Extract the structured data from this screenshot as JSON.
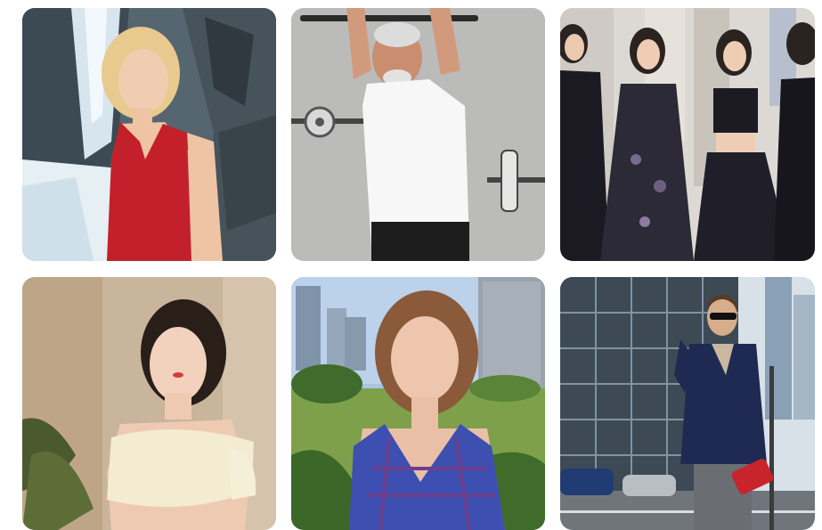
{
  "gallery": {
    "items": [
      {
        "alt": "",
        "palette": {
          "bg": "#4d5b63",
          "accent": "#c8202b",
          "light": "#dfeaf0"
        }
      },
      {
        "alt": "",
        "palette": {
          "bg": "#b3b3b1",
          "accent": "#f3f3f3",
          "light": "#2b2b2b"
        }
      },
      {
        "alt": "",
        "palette": {
          "bg": "#d9d5cf",
          "accent": "#1f1d27",
          "light": "#8d90a6"
        }
      },
      {
        "alt": "",
        "palette": {
          "bg": "#c9b39a",
          "accent": "#f3ead3",
          "light": "#2d2722"
        }
      },
      {
        "alt": "",
        "palette": {
          "bg": "#93b4d8",
          "accent": "#3d4fb0",
          "light": "#6a9a3b"
        }
      },
      {
        "alt": "",
        "palette": {
          "bg": "#8fa5b5",
          "accent": "#1f2a52",
          "light": "#d6dde3"
        }
      }
    ]
  }
}
